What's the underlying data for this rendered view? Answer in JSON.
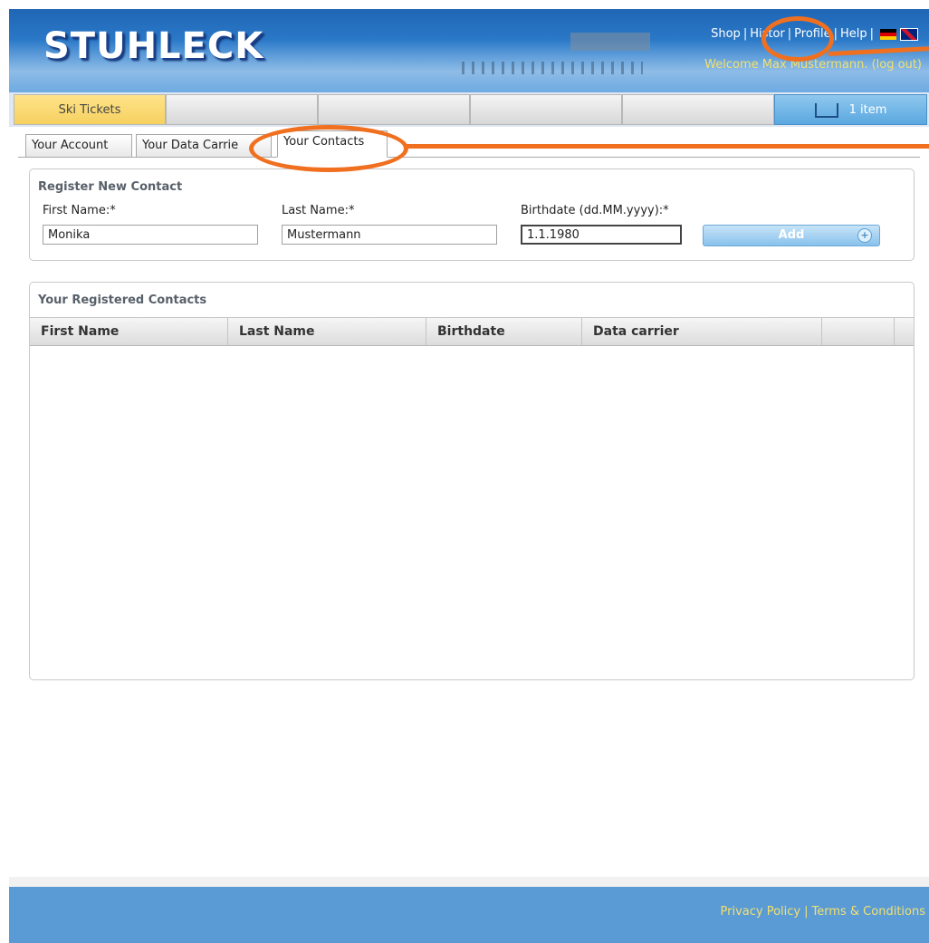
{
  "header": {
    "logo_text": "STUHLECK",
    "links": [
      {
        "label": "Shop"
      },
      {
        "label": "Histor"
      },
      {
        "label": "Profile"
      },
      {
        "label": "Help"
      }
    ],
    "welcome_text": "Welcome Max Mustermann.",
    "logout_label": "(log out)"
  },
  "main_tabs": [
    {
      "label": "Ski Tickets",
      "active": true
    },
    {
      "label": ""
    },
    {
      "label": ""
    },
    {
      "label": ""
    },
    {
      "label": ""
    }
  ],
  "cart": {
    "label": "1 item"
  },
  "sub_tabs": [
    {
      "label": "Your Account"
    },
    {
      "label": "Your Data Carrie"
    },
    {
      "label": "Your Contacts",
      "active": true
    }
  ],
  "register": {
    "title": "Register New Contact",
    "first_name_label": "First Name:*",
    "first_name_value": "Monika",
    "last_name_label": "Last Name:*",
    "last_name_value": "Mustermann",
    "birthdate_label": "Birthdate (dd.MM.yyyy):*",
    "birthdate_value": "1.1.1980",
    "add_label": "Add"
  },
  "contacts": {
    "title": "Your Registered Contacts",
    "columns": [
      "First Name",
      "Last Name",
      "Birthdate",
      "Data carrier"
    ],
    "rows": []
  },
  "footer": {
    "privacy_label": "Privacy Policy",
    "terms_label": "Terms & Conditions"
  },
  "colors": {
    "annotation": "#f07020",
    "header_blue": "#2d7ccb",
    "footer_blue": "#5b9bd5",
    "active_tab": "#f6d160",
    "link_yellow": "#f0e070"
  }
}
